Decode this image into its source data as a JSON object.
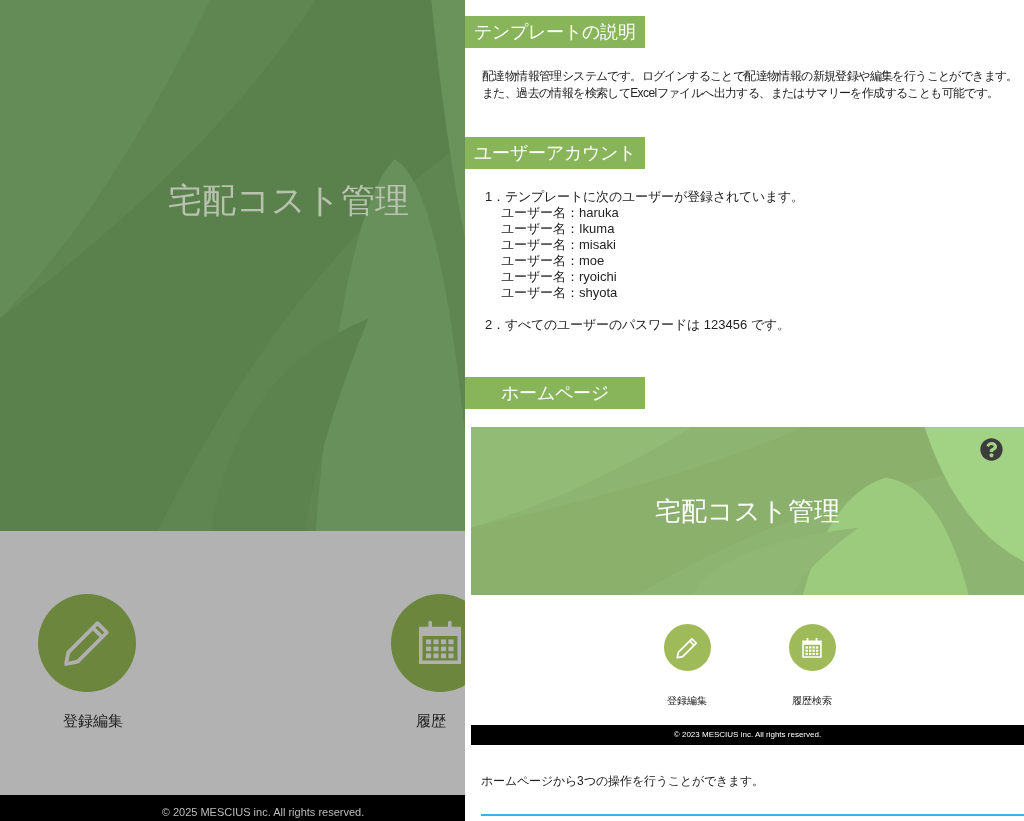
{
  "background_page": {
    "title": "宅配コスト管理",
    "buttons": [
      {
        "label": "登録編集",
        "kind": "pencil"
      },
      {
        "label": "履歴",
        "kind": "calendar"
      }
    ],
    "footer": "© 2025 MESCIUS inc. All rights reserved."
  },
  "help_panel": {
    "sections": [
      {
        "heading": "テンプレートの説明",
        "paragraphs": [
          "配達物情報管理システムです。ログインすることで配達物情報の新規登録や編集を行うことができます。また、過去の情報を検索してExcelファイルへ出力する、またはサマリーを作成することも可能です。"
        ]
      },
      {
        "heading": "ユーザーアカウント",
        "list": [
          {
            "marker": "1．",
            "text": "テンプレートに次のユーザーが登録されています。",
            "sub_items": [
              "ユーザー名：haruka",
              "ユーザー名：Ikuma",
              "ユーザー名：misaki",
              "ユーザー名：moe",
              "ユーザー名：ryoichi",
              "ユーザー名：shyota"
            ]
          },
          {
            "marker": "2．",
            "text": "すべてのユーザーのパスワードは 123456 です。"
          }
        ]
      },
      {
        "heading": "ホームページ",
        "screenshot": {
          "title": "宅配コスト管理",
          "buttons": [
            {
              "label": "登録編集",
              "kind": "pencil"
            },
            {
              "label": "履歴検索",
              "kind": "calendar"
            }
          ],
          "footer": "© 2023 MESCIUS inc. All rights reserved."
        },
        "paragraphs": [
          "ホームページから3つの操作を行うことができます。"
        ]
      }
    ]
  }
}
